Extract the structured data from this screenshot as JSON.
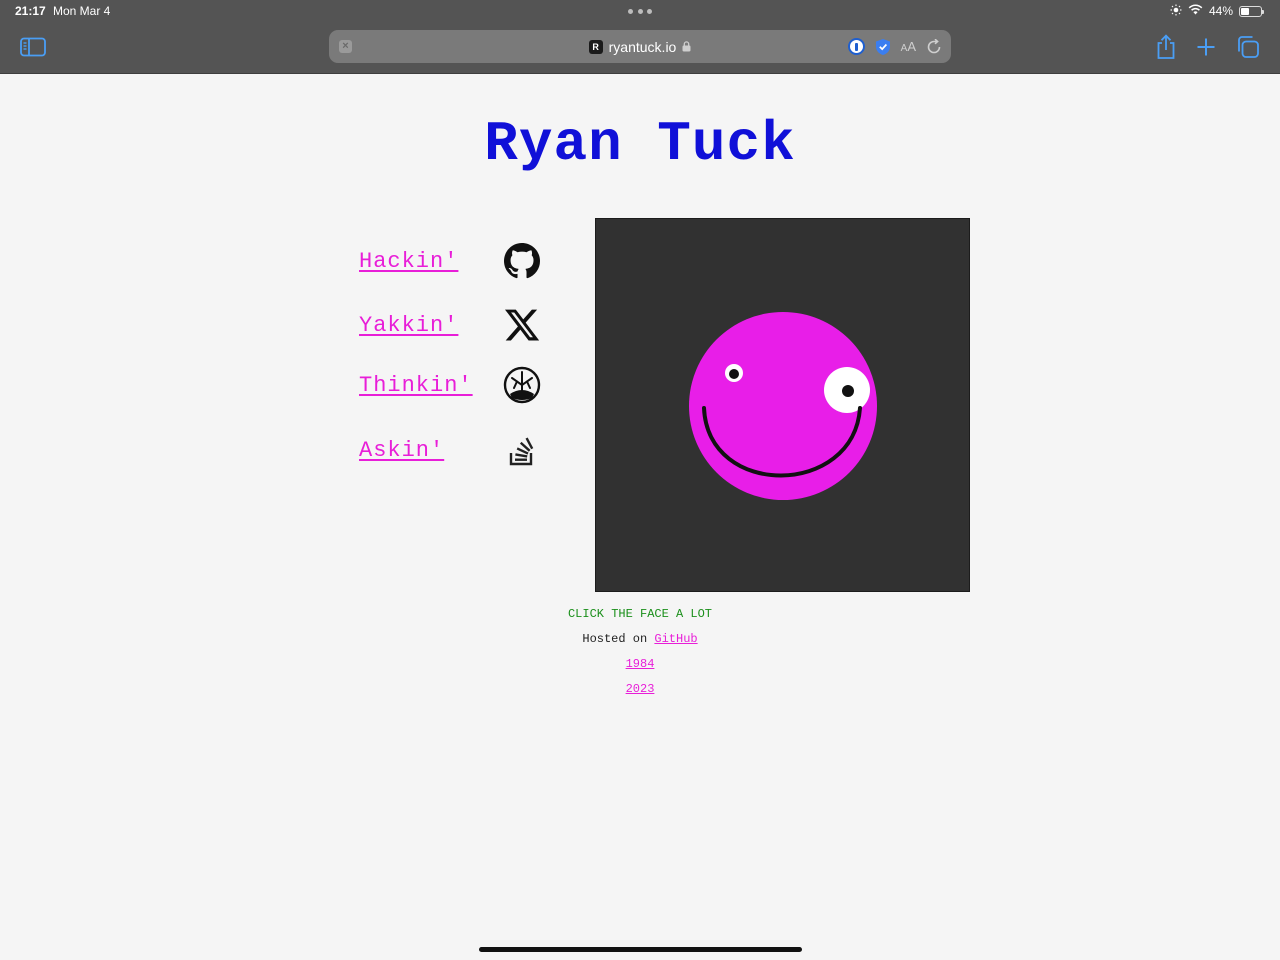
{
  "status_bar": {
    "time": "21:17",
    "date": "Mon Mar 4",
    "battery_percent": "44%",
    "battery_level": 0.44
  },
  "browser": {
    "favicon_letter": "R",
    "domain": "ryantuck.io",
    "text_size_small": "A",
    "text_size_large": "A",
    "icons": {
      "sidebar": "sidebar-icon",
      "close_tab": "close-icon",
      "lock": "lock-icon",
      "password_manager": "password-manager-icon",
      "privacy": "shield-check-icon",
      "reload": "reload-icon",
      "share": "share-icon",
      "new_tab": "plus-icon",
      "tabs": "tabs-overview-icon"
    },
    "accent_color": "#4a9ef5"
  },
  "page": {
    "title": "Ryan Tuck",
    "title_color": "#1010d8",
    "link_color": "#e81ed8",
    "links": [
      {
        "label": "Hackin'",
        "icon": "github-icon"
      },
      {
        "label": "Yakkin'",
        "icon": "x-icon"
      },
      {
        "label": "Thinkin'",
        "icon": "tree-of-life-icon"
      },
      {
        "label": "Askin'",
        "icon": "stack-overflow-icon"
      }
    ],
    "face": {
      "background": "#313131",
      "face_color": "#e81ee8"
    },
    "hint": "CLICK THE FACE A LOT",
    "hint_color": "#1a8f1a",
    "hosted_prefix": "Hosted on",
    "hosted_link": "GitHub",
    "year_links": [
      "1984",
      "2023"
    ]
  }
}
